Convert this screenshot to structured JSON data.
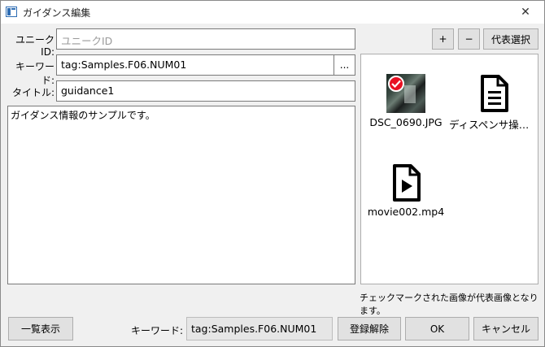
{
  "window": {
    "title": "ガイダンス編集",
    "close_label": "✕"
  },
  "form": {
    "unique_id": {
      "label": "ユニークID:",
      "value": "",
      "placeholder": "ユニークID"
    },
    "keyword": {
      "label": "キーワード:",
      "value": "tag:Samples.F06.NUM01",
      "browse_label": "..."
    },
    "title": {
      "label": "タイトル:",
      "value": "guidance1"
    },
    "body_text": "ガイダンス情報のサンプルです。"
  },
  "media_toolbar": {
    "add_label": "+",
    "remove_label": "−",
    "representative_label": "代表選択"
  },
  "media": [
    {
      "caption": "DSC_0690.JPG",
      "kind": "image",
      "representative": true,
      "icon": "photo-thumbnail"
    },
    {
      "caption": "ディスペンサ操作…",
      "kind": "document",
      "representative": false,
      "icon": "document-icon"
    },
    {
      "caption": "movie002.mp4",
      "kind": "video",
      "representative": false,
      "icon": "video-file-icon"
    }
  ],
  "media_note": "チェックマークされた画像が代表画像となります。",
  "footer": {
    "list_view_label": "一覧表示",
    "keyword_label": "キーワード:",
    "keyword_value": "tag:Samples.F06.NUM01",
    "unregister_label": "登録解除",
    "ok_label": "OK",
    "cancel_label": "キャンセル"
  },
  "colors": {
    "check_badge": "#e81123",
    "window_bg": "#f0f0f0",
    "button_bg": "#e1e1e1"
  }
}
